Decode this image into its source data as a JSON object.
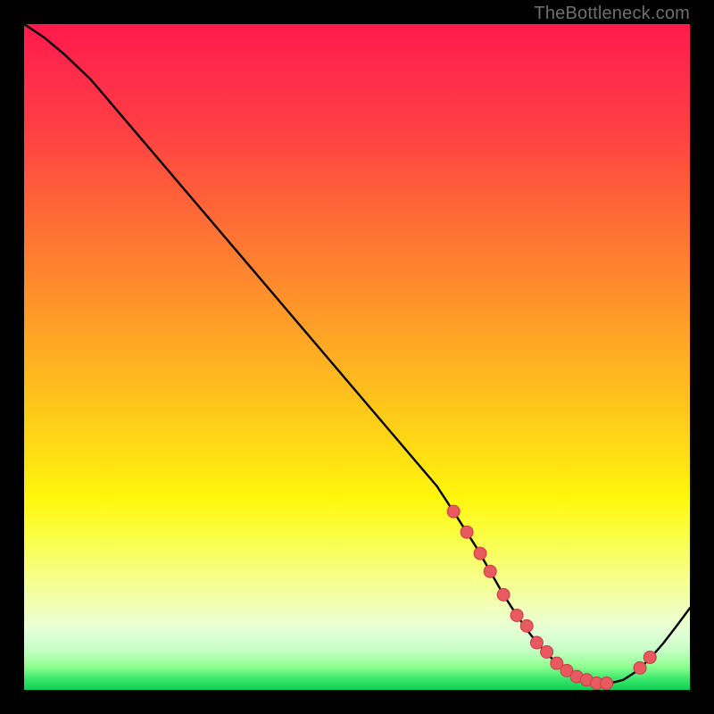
{
  "watermark": "TheBottleneck.com",
  "colors": {
    "curve": "#000000",
    "dot_fill": "#e85a5f",
    "dot_stroke": "#c83c44"
  },
  "chart_data": {
    "type": "line",
    "title": "",
    "xlabel": "",
    "ylabel": "",
    "xlim": [
      0,
      100
    ],
    "ylim": [
      0,
      100
    ],
    "series": [
      {
        "name": "bottleneck-curve",
        "x": [
          0,
          3,
          6,
          10,
          14,
          18,
          22,
          26,
          30,
          34,
          38,
          42,
          46,
          50,
          54,
          58,
          62,
          65,
          68,
          70,
          72,
          74,
          76,
          78,
          80,
          82,
          84,
          86,
          88,
          90,
          92,
          94,
          96,
          98,
          100
        ],
        "values": [
          100,
          98,
          95.5,
          91.7,
          87.0,
          82.3,
          77.6,
          72.9,
          68.2,
          63.5,
          58.8,
          54.1,
          49.4,
          44.7,
          40.0,
          35.3,
          30.6,
          26.0,
          21.3,
          17.8,
          14.3,
          11.2,
          8.4,
          6.0,
          4.0,
          2.5,
          1.5,
          1.0,
          1.0,
          1.5,
          2.8,
          4.7,
          7.0,
          9.6,
          12.3
        ]
      }
    ],
    "dots": {
      "name": "highlight-points",
      "x": [
        64.5,
        66.5,
        68.5,
        70.0,
        72.0,
        74.0,
        75.5,
        77.0,
        78.5,
        80.0,
        81.5,
        83.0,
        84.5,
        86.0,
        87.5,
        92.5,
        94.0
      ],
      "values": [
        26.8,
        23.7,
        20.5,
        17.8,
        14.3,
        11.2,
        9.6,
        7.1,
        5.7,
        4.0,
        2.9,
        2.0,
        1.5,
        1.0,
        1.0,
        3.3,
        4.9
      ]
    }
  }
}
